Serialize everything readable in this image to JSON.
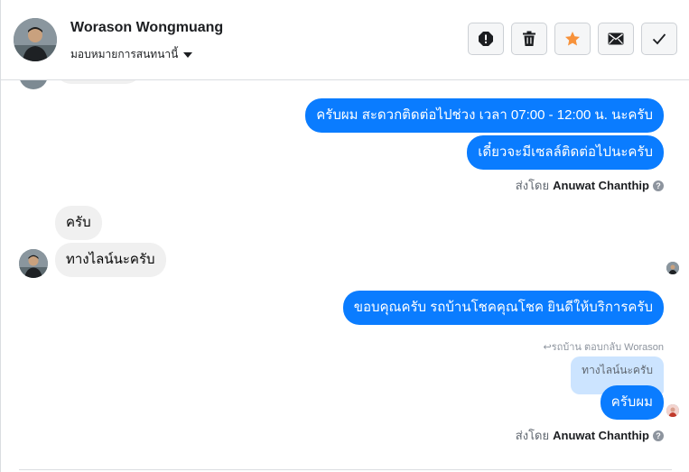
{
  "header": {
    "contact_name": "Worason Wongmuang",
    "assign_label": "มอบหมายการสนทนานี้",
    "actions": [
      {
        "name": "spam-button",
        "icon": "exclamation-icon"
      },
      {
        "name": "delete-button",
        "icon": "trash-icon"
      },
      {
        "name": "star-button",
        "icon": "star-icon",
        "color": "#f7923b"
      },
      {
        "name": "mark-unread-button",
        "icon": "envelope-icon"
      },
      {
        "name": "mark-done-button",
        "icon": "check-icon"
      }
    ]
  },
  "messages": {
    "out_1": "ครับผม สะดวกติดต่อไปช่วง เวลา 07:00 - 12:00 น. นะครับ",
    "out_2": "เดี๋ยวจะมีเซลล์ติดต่อไปนะครับ",
    "sent_by_prefix": "ส่งโดย",
    "sent_by_name": "Anuwat Chanthip",
    "in_1": "ครับ",
    "in_2": "ทางไลน์นะครับ",
    "out_3": "ขอบคุณครับ รถบ้านโชคคุณโชค ยินดีให้บริการครับ",
    "reply_note": "รถบ้าน ตอบกลับ Worason",
    "quoted_text": "ทางไลน์นะครับ",
    "out_4": "ครับผม",
    "sent_by_prefix_2": "ส่งโดย",
    "sent_by_name_2": "Anuwat Chanthip"
  },
  "colors": {
    "brand_blue": "#0a7cff",
    "incoming_gray": "#f0f0f0",
    "star_orange": "#f7923b"
  }
}
